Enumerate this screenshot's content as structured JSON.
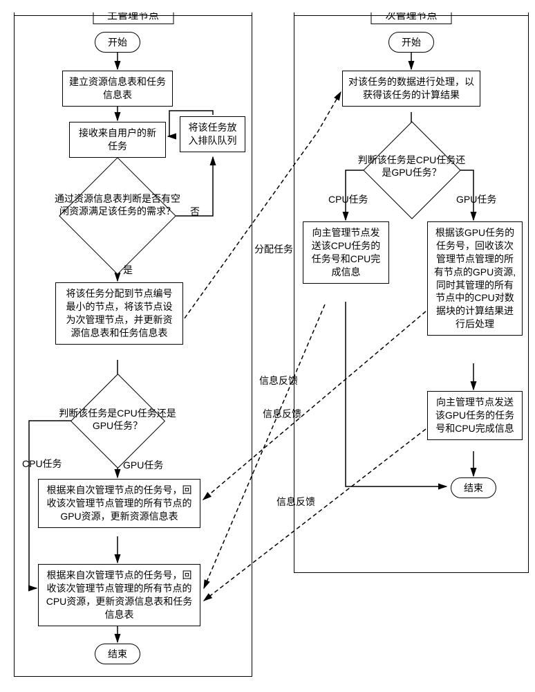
{
  "left_panel": {
    "title": "主管理节点",
    "start": "开始",
    "b1": "建立资源信息表和任务信息表",
    "b2": "接收来自用户的新任务",
    "b_queue": "将该任务放入排队队列",
    "d1": "通过资源信息表判断是否有空闲资源满足该任务的需求？",
    "yes": "是",
    "no": "否",
    "b3": "将该任务分配到节点编号最小的节点，将该节点设为次管理节点，并更新资源信息表和任务信息表",
    "d2": "判断该任务是CPU任务还是GPU任务？",
    "cpu_task": "CPU任务",
    "gpu_task": "GPU任务",
    "b4": "根据来自次管理节点的任务号，回收该次管理节点管理的所有节点的GPU资源，更新资源信息表",
    "b5": "根据来自次管理节点的任务号，回收该次管理节点管理的所有节点的CPU资源，更新资源信息表和任务信息表",
    "end": "结束"
  },
  "right_panel": {
    "title": "次管理节点",
    "start": "开始",
    "b1": "对该任务的数据进行处理，以获得该任务的计算结果",
    "d1": "判断该任务是CPU任务还是GPU任务？",
    "cpu_task": "CPU任务",
    "gpu_task": "GPU任务",
    "b_cpu": "向主管理节点发送该CPU任务的任务号和CPU完成信息",
    "b_gpu": "根据该GPU任务的任务号，回收该次管理节点管理的所有节点的GPU资源, 同时其管理的所有节点中的CPU对数据块的计算结果进行后处理",
    "b_gpu2": "向主管理节点发送该GPU任务的任务号和CPU完成信息",
    "end": "结束"
  },
  "cross_labels": {
    "assign": "分配任务",
    "feedback1": "信息反馈",
    "feedback2": "信息反馈",
    "feedback3": "信息反馈"
  }
}
